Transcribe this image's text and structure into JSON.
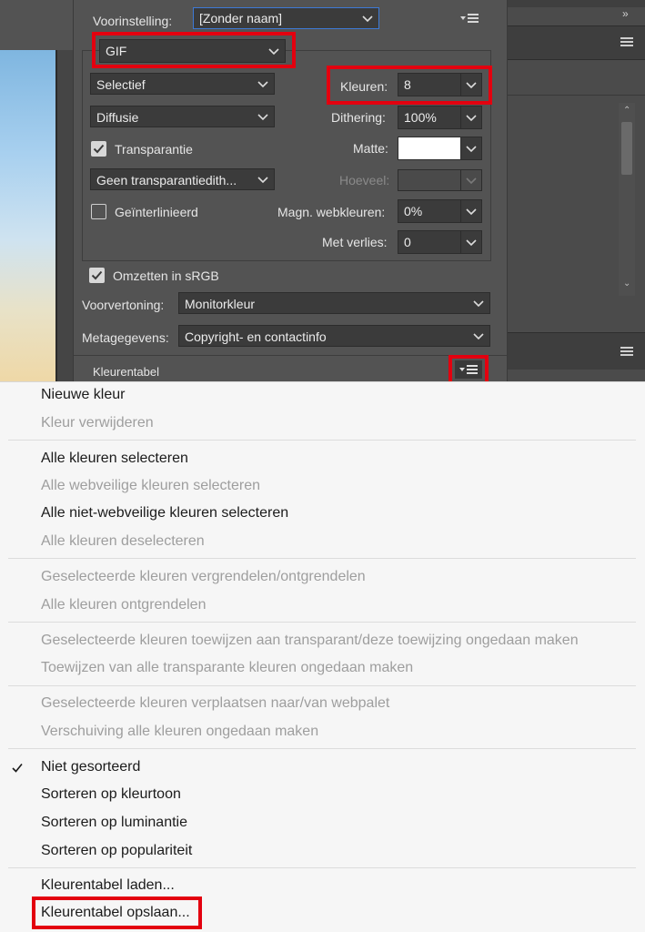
{
  "panel": {
    "preset_label": "Voorinstelling:",
    "preset_value": "[Zonder naam]",
    "format_value": "GIF",
    "reduction_value": "Selectief",
    "dither_method_value": "Diffusie",
    "transparency_label": "Transparantie",
    "transparency_checked": true,
    "transp_dither_value": "Geen transparantiedith...",
    "interlaced_label": "Geïnterlinieerd",
    "interlaced_checked": false,
    "colors_label": "Kleuren:",
    "colors_value": "8",
    "dithering_label": "Dithering:",
    "dithering_value": "100%",
    "matte_label": "Matte:",
    "matte_color": "#ffffff",
    "amount_label": "Hoeveel:",
    "amount_value": "",
    "web_snap_label": "Magn. webkleuren:",
    "web_snap_value": "0%",
    "lossy_label": "Met verlies:",
    "lossy_value": "0",
    "srgb_label": "Omzetten in sRGB",
    "srgb_checked": true,
    "preview_label": "Voorvertoning:",
    "preview_value": "Monitorkleur",
    "metadata_label": "Metagegevens:",
    "metadata_value": "Copyright- en contactinfo",
    "color_table_label": "Kleurentabel"
  },
  "menu": {
    "groups": [
      [
        {
          "label": "Nieuwe kleur",
          "enabled": true
        },
        {
          "label": "Kleur verwijderen",
          "enabled": false
        }
      ],
      [
        {
          "label": "Alle kleuren selecteren",
          "enabled": true
        },
        {
          "label": "Alle webveilige kleuren selecteren",
          "enabled": false
        },
        {
          "label": "Alle niet-webveilige kleuren selecteren",
          "enabled": true
        },
        {
          "label": "Alle kleuren deselecteren",
          "enabled": false
        }
      ],
      [
        {
          "label": "Geselecteerde kleuren vergrendelen/ontgrendelen",
          "enabled": false
        },
        {
          "label": "Alle kleuren ontgrendelen",
          "enabled": false
        }
      ],
      [
        {
          "label": "Geselecteerde kleuren toewijzen aan transparant/deze toewijzing ongedaan maken",
          "enabled": false
        },
        {
          "label": "Toewijzen van alle transparante kleuren ongedaan maken",
          "enabled": false
        }
      ],
      [
        {
          "label": "Geselecteerde kleuren verplaatsen naar/van webpalet",
          "enabled": false
        },
        {
          "label": "Verschuiving alle kleuren ongedaan maken",
          "enabled": false
        }
      ],
      [
        {
          "label": "Niet gesorteerd",
          "enabled": true,
          "checked": true
        },
        {
          "label": "Sorteren op kleurtoon",
          "enabled": true
        },
        {
          "label": "Sorteren op luminantie",
          "enabled": true
        },
        {
          "label": "Sorteren op populariteit",
          "enabled": true
        }
      ],
      [
        {
          "label": "Kleurentabel laden...",
          "enabled": true
        },
        {
          "label": "Kleurentabel opslaan...",
          "enabled": true
        }
      ]
    ]
  },
  "colors": {
    "highlight": "#e3000f",
    "panel_bg": "#535353",
    "menu_bg": "#f6f6f6"
  }
}
